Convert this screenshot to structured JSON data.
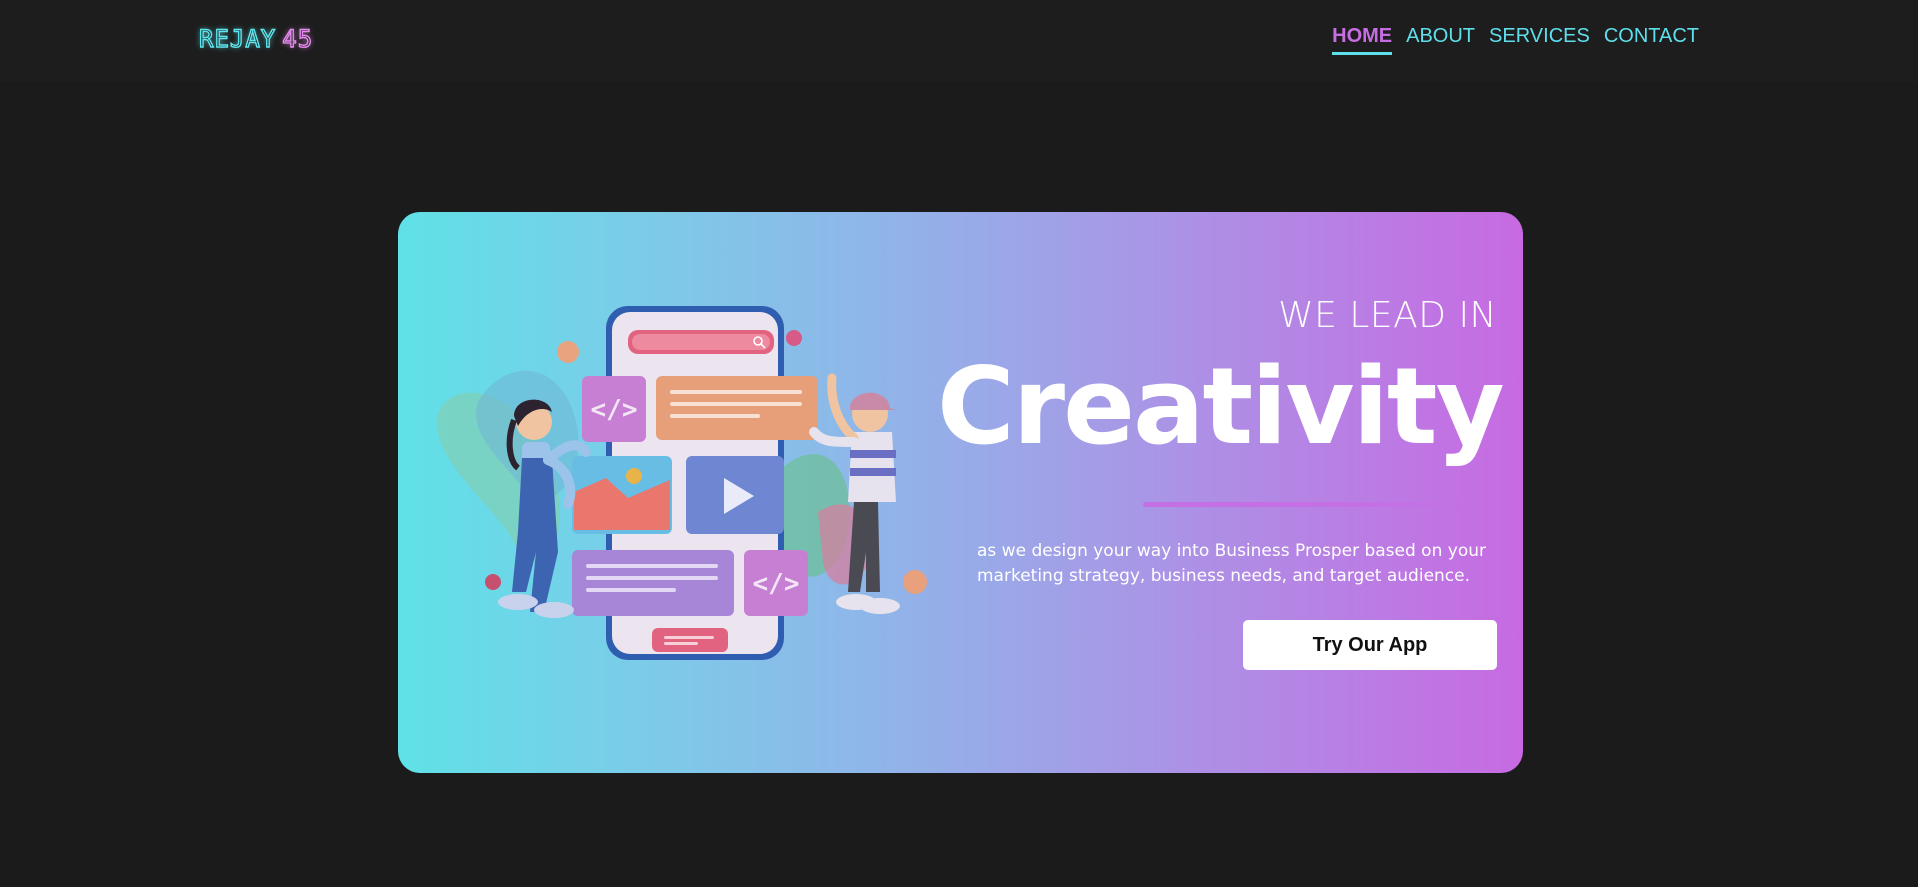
{
  "header": {
    "logo_left": "REJAY",
    "logo_right": "45",
    "nav": [
      {
        "label": "HOME",
        "active": true
      },
      {
        "label": "ABOUT",
        "active": false
      },
      {
        "label": "SERVICES",
        "active": false
      },
      {
        "label": "CONTACT",
        "active": false
      }
    ]
  },
  "hero": {
    "kicker": "WE LEAD IN",
    "headline": "Creativity",
    "description": "as we design your way into Business Prosper based on your marketing strategy, business needs, and target audience.",
    "cta_label": "Try Our App",
    "illustration_icon": "app-development-illustration"
  },
  "colors": {
    "page_bg": "#1b1b1b",
    "accent_cyan": "#5ee0ec",
    "accent_magenta": "#c66de2",
    "hero_gradient_start": "#5fe1e7",
    "hero_gradient_end": "#c76ae2"
  }
}
